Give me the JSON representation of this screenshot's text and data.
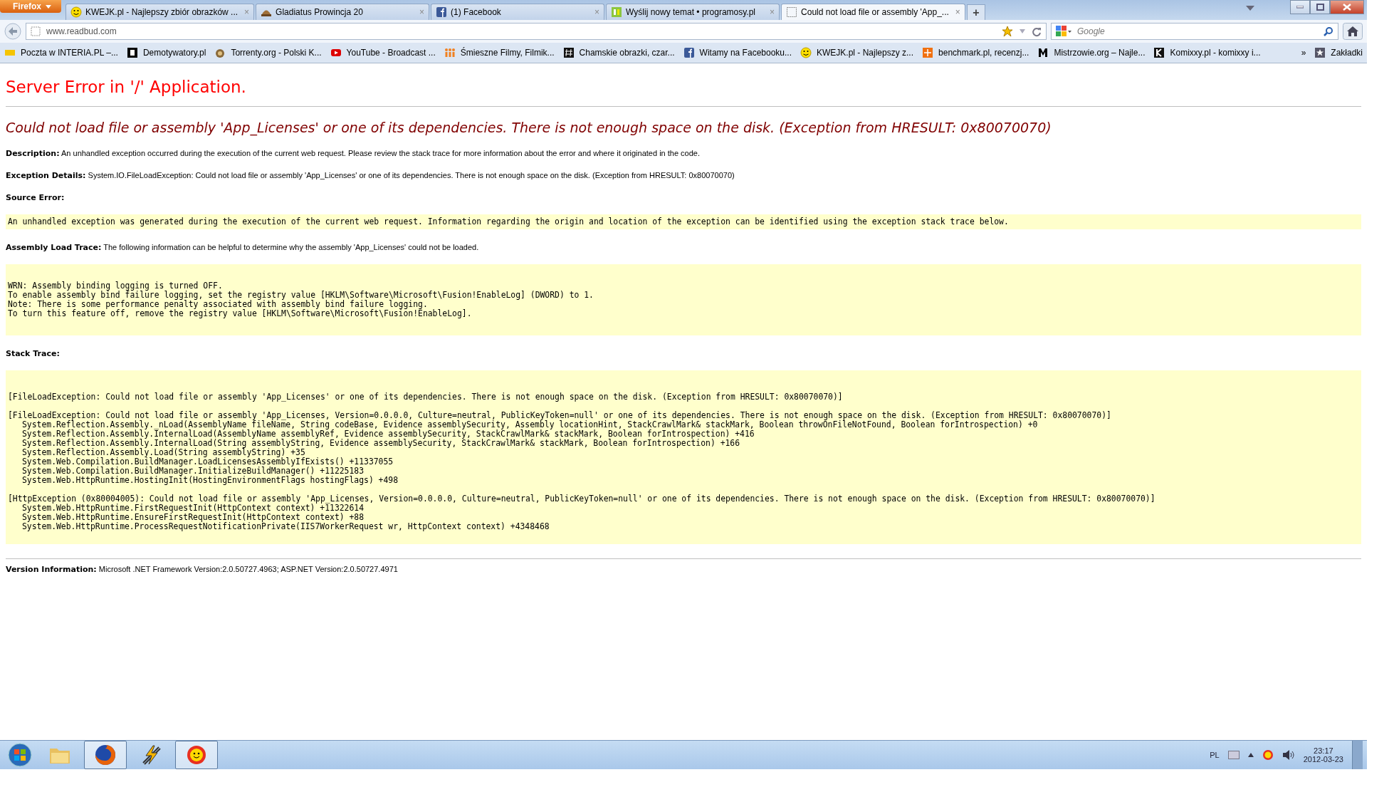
{
  "browser": {
    "menu_button": "Firefox",
    "tabs": [
      {
        "label": "KWEJK.pl - Najlepszy zbiór obrazków ...",
        "close": "×",
        "selected": false
      },
      {
        "label": "Gladiatus Prowincja 20",
        "close": "×",
        "selected": false
      },
      {
        "label": "(1) Facebook",
        "close": "×",
        "selected": false
      },
      {
        "label": "Wyślij nowy temat • programosy.pl",
        "close": "×",
        "selected": false
      },
      {
        "label": "Could not load file or assembly 'App_...",
        "close": "×",
        "selected": true
      }
    ],
    "new_tab": "+",
    "url": "www.readbud.com",
    "search_placeholder": "Google",
    "bookmarks": [
      "Poczta w INTERIA.PL –...",
      "Demotywatory.pl",
      "Torrenty.org - Polski K...",
      "YouTube - Broadcast ...",
      "Śmieszne Filmy, Filmik...",
      "Chamskie obrazki, czar...",
      "Witamy na Facebooku...",
      "KWEJK.pl - Najlepszy z...",
      "benchmark.pl, recenzj...",
      "Mistrzowie.org – Najle...",
      "Komixxy.pl - komixxy i..."
    ],
    "overflow": "»",
    "bookmarks_menu": "Zakładki"
  },
  "page": {
    "title": "Server Error in '/' Application.",
    "error_heading": "Could not load file or assembly 'App_Licenses' or one of its dependencies. There is not enough space on the disk. (Exception from HRESULT: 0x80070070)",
    "description": {
      "label": "Description:",
      "text": "An unhandled exception occurred during the execution of the current web request. Please review the stack trace for more information about the error and where it originated in the code."
    },
    "exception_details": {
      "label": "Exception Details:",
      "text": "System.IO.FileLoadException: Could not load file or assembly 'App_Licenses' or one of its dependencies. There is not enough space on the disk. (Exception from HRESULT: 0x80070070)"
    },
    "source_error": {
      "label": "Source Error:",
      "text": "An unhandled exception was generated during the execution of the current web request. Information regarding the origin and location of the exception can be identified using the exception stack trace below."
    },
    "assembly_load_trace": {
      "label": "Assembly Load Trace:",
      "text": "The following information can be helpful to determine why the assembly 'App_Licenses' could not be loaded.",
      "lines": [
        "WRN: Assembly binding logging is turned OFF.",
        "To enable assembly bind failure logging, set the registry value [HKLM\\Software\\Microsoft\\Fusion!EnableLog] (DWORD) to 1.",
        "Note: There is some performance penalty associated with assembly bind failure logging.",
        "To turn this feature off, remove the registry value [HKLM\\Software\\Microsoft\\Fusion!EnableLog]."
      ]
    },
    "stack_trace": {
      "label": "Stack Trace:",
      "blocks": [
        {
          "header": "[FileLoadException: Could not load file or assembly 'App_Licenses' or one of its dependencies. There is not enough space on the disk. (Exception from HRESULT: 0x80070070)]"
        },
        {
          "header": "[FileLoadException: Could not load file or assembly 'App_Licenses, Version=0.0.0.0, Culture=neutral, PublicKeyToken=null' or one of its dependencies. There is not enough space on the disk. (Exception from HRESULT: 0x80070070)]",
          "frames": [
            "System.Reflection.Assembly._nLoad(AssemblyName fileName, String codeBase, Evidence assemblySecurity, Assembly locationHint, StackCrawlMark& stackMark, Boolean throwOnFileNotFound, Boolean forIntrospection) +0",
            "System.Reflection.Assembly.InternalLoad(AssemblyName assemblyRef, Evidence assemblySecurity, StackCrawlMark& stackMark, Boolean forIntrospection) +416",
            "System.Reflection.Assembly.InternalLoad(String assemblyString, Evidence assemblySecurity, StackCrawlMark& stackMark, Boolean forIntrospection) +166",
            "System.Reflection.Assembly.Load(String assemblyString) +35",
            "System.Web.Compilation.BuildManager.LoadLicensesAssemblyIfExists() +11337055",
            "System.Web.Compilation.BuildManager.InitializeBuildManager() +11225183",
            "System.Web.HttpRuntime.HostingInit(HostingEnvironmentFlags hostingFlags) +498"
          ]
        },
        {
          "header": "[HttpException (0x80004005): Could not load file or assembly 'App_Licenses, Version=0.0.0.0, Culture=neutral, PublicKeyToken=null' or one of its dependencies. There is not enough space on the disk. (Exception from HRESULT: 0x80070070)]",
          "frames": [
            "System.Web.HttpRuntime.FirstRequestInit(HttpContext context) +11322614",
            "System.Web.HttpRuntime.EnsureFirstRequestInit(HttpContext context) +88",
            "System.Web.HttpRuntime.ProcessRequestNotificationPrivate(IIS7WorkerRequest wr, HttpContext context) +4348468"
          ]
        }
      ]
    },
    "version": {
      "label": "Version Information:",
      "text": "Microsoft .NET Framework Version:2.0.50727.4963; ASP.NET Version:2.0.50727.4971"
    }
  },
  "taskbar": {
    "apps": [
      {
        "active": false
      },
      {
        "active": true
      },
      {
        "active": false
      },
      {
        "active": true
      }
    ],
    "language": "PL",
    "time": "23:17",
    "date": "2012-03-23"
  }
}
